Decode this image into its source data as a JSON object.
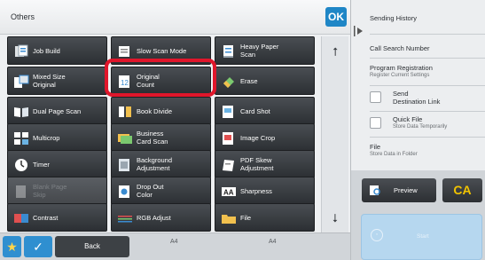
{
  "panel": {
    "title": "Others",
    "ok_label": "OK"
  },
  "functions": [
    {
      "name": "job-build",
      "label": "Job Build",
      "icon": "job-build-icon",
      "enabled": true
    },
    {
      "name": "slow-scan-mode",
      "label": "Slow Scan Mode",
      "icon": "slow-scan-icon",
      "enabled": true
    },
    {
      "name": "heavy-paper-scan",
      "label": "Heavy Paper\nScan",
      "icon": "heavy-paper-icon",
      "enabled": true
    },
    {
      "name": "mixed-size-original",
      "label": "Mixed Size\nOriginal",
      "icon": "mixed-size-icon",
      "enabled": true
    },
    {
      "name": "original-count",
      "label": "Original\nCount",
      "icon": "original-count-icon",
      "enabled": true
    },
    {
      "name": "erase",
      "label": "Erase",
      "icon": "erase-icon",
      "enabled": true
    },
    {
      "name": "dual-page-scan",
      "label": "Dual Page Scan",
      "icon": "dual-page-icon",
      "enabled": true
    },
    {
      "name": "book-divide",
      "label": "Book Divide",
      "icon": "book-divide-icon",
      "enabled": true
    },
    {
      "name": "card-shot",
      "label": "Card Shot",
      "icon": "card-shot-icon",
      "enabled": true
    },
    {
      "name": "multicrop",
      "label": "Multicrop",
      "icon": "multicrop-icon",
      "enabled": true
    },
    {
      "name": "business-card-scan",
      "label": "Business\nCard Scan",
      "icon": "business-card-icon",
      "enabled": true
    },
    {
      "name": "image-crop",
      "label": "Image Crop",
      "icon": "image-crop-icon",
      "enabled": true
    },
    {
      "name": "timer",
      "label": "Timer",
      "icon": "timer-icon",
      "enabled": true
    },
    {
      "name": "background-adjustment",
      "label": "Background\nAdjustment",
      "icon": "background-adjust-icon",
      "enabled": true
    },
    {
      "name": "pdf-skew-adjustment",
      "label": "PDF Skew\nAdjustment",
      "icon": "pdf-skew-icon",
      "enabled": true
    },
    {
      "name": "blank-page-skip",
      "label": "Blank Page\nSkip",
      "icon": "blank-page-icon",
      "enabled": false
    },
    {
      "name": "drop-out-color",
      "label": "Drop Out\nColor",
      "icon": "drop-out-color-icon",
      "enabled": true
    },
    {
      "name": "sharpness",
      "label": "Sharpness",
      "icon": "sharpness-icon",
      "enabled": true
    },
    {
      "name": "contrast",
      "label": "Contrast",
      "icon": "contrast-icon",
      "enabled": true
    },
    {
      "name": "rgb-adjust",
      "label": "RGB Adjust",
      "icon": "rgb-adjust-icon",
      "enabled": true
    },
    {
      "name": "file",
      "label": "File",
      "icon": "file-icon",
      "enabled": true
    }
  ],
  "bottom_bar": {
    "back_label": "Back",
    "paper_size_1": "A4",
    "paper_size_2": "A4"
  },
  "side_panel": {
    "sending_history": "Sending History",
    "call_search_number": "Call Search Number",
    "program_registration": "Program Registration",
    "program_registration_sub": "Register Current Settings",
    "send_destination_link": "Send\nDestination Link",
    "quick_file": "Quick File",
    "quick_file_sub": "Store Data Temporarily",
    "file": "File",
    "file_sub": "Store Data in Folder"
  },
  "actions": {
    "preview_label": "Preview",
    "ca_label": "CA",
    "start_label": "Start"
  },
  "colors": {
    "ok": "#1f86c6",
    "highlight": "#e0162b",
    "ca_text": "#f2c400",
    "start": "#b6d7ef"
  }
}
